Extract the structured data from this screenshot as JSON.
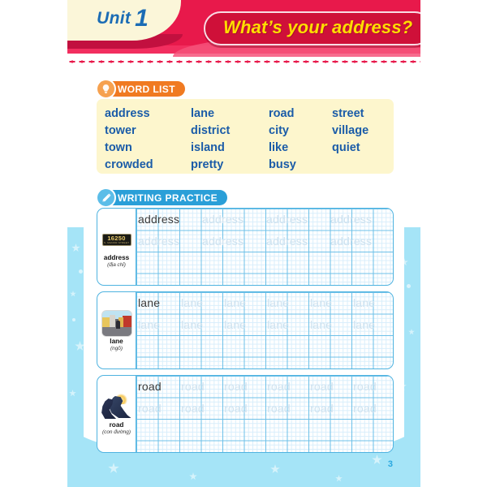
{
  "header": {
    "unit_label": "Unit",
    "unit_number": "1",
    "title": "What’s your address?",
    "colors": {
      "banner": "#e8194b",
      "tab": "#fbf6d9",
      "title_text": "#ffdd00",
      "title_pill": "#cf1039",
      "unit_text": "#1b6cb5"
    }
  },
  "word_list": {
    "chip_label": "WORD LIST",
    "chip_icon": "lightbulb-icon",
    "chip_color": "#f07a21",
    "box_color": "#fdf6cd",
    "word_color": "#1b5ca8",
    "words": [
      "address",
      "lane",
      "road",
      "street",
      "tower",
      "district",
      "city",
      "village",
      "town",
      "island",
      "like",
      "quiet",
      "crowded",
      "pretty",
      "busy",
      ""
    ]
  },
  "writing_practice": {
    "chip_label": "WRITING PRACTICE",
    "chip_icon": "pencil-icon",
    "chip_color": "#2a9fd8",
    "rows": [
      {
        "word": "address",
        "vietnamese": "(địa chỉ)",
        "picture": "address-plate-icon",
        "plate_number": "16250",
        "plate_subtext": "S. MANOR STREET",
        "line1": [
          "address",
          "address",
          "address",
          "address"
        ],
        "line2": [
          "address",
          "address",
          "address",
          "address"
        ],
        "repeats_per_line": 4,
        "first_word_solid": true
      },
      {
        "word": "lane",
        "vietnamese": "(ngõ)",
        "picture": "street-scene-icon",
        "line1": [
          "lane",
          "lane",
          "lane",
          "lane",
          "lane",
          "lane"
        ],
        "line2": [
          "lane",
          "lane",
          "lane",
          "lane",
          "lane",
          "lane"
        ],
        "repeats_per_line": 6,
        "first_word_solid": true
      },
      {
        "word": "road",
        "vietnamese": "(con đường)",
        "picture": "winding-road-icon",
        "line1": [
          "road",
          "road",
          "road",
          "road",
          "road",
          "road"
        ],
        "line2": [
          "road",
          "road",
          "road",
          "road",
          "road",
          "road"
        ],
        "repeats_per_line": 6,
        "first_word_solid": true
      }
    ]
  },
  "footer": {
    "page_number": "3",
    "page_number_color": "#2aa8e0"
  },
  "decoration": {
    "water_color": "#a5e4f7",
    "dotted_rule_color": "#e8194b"
  }
}
